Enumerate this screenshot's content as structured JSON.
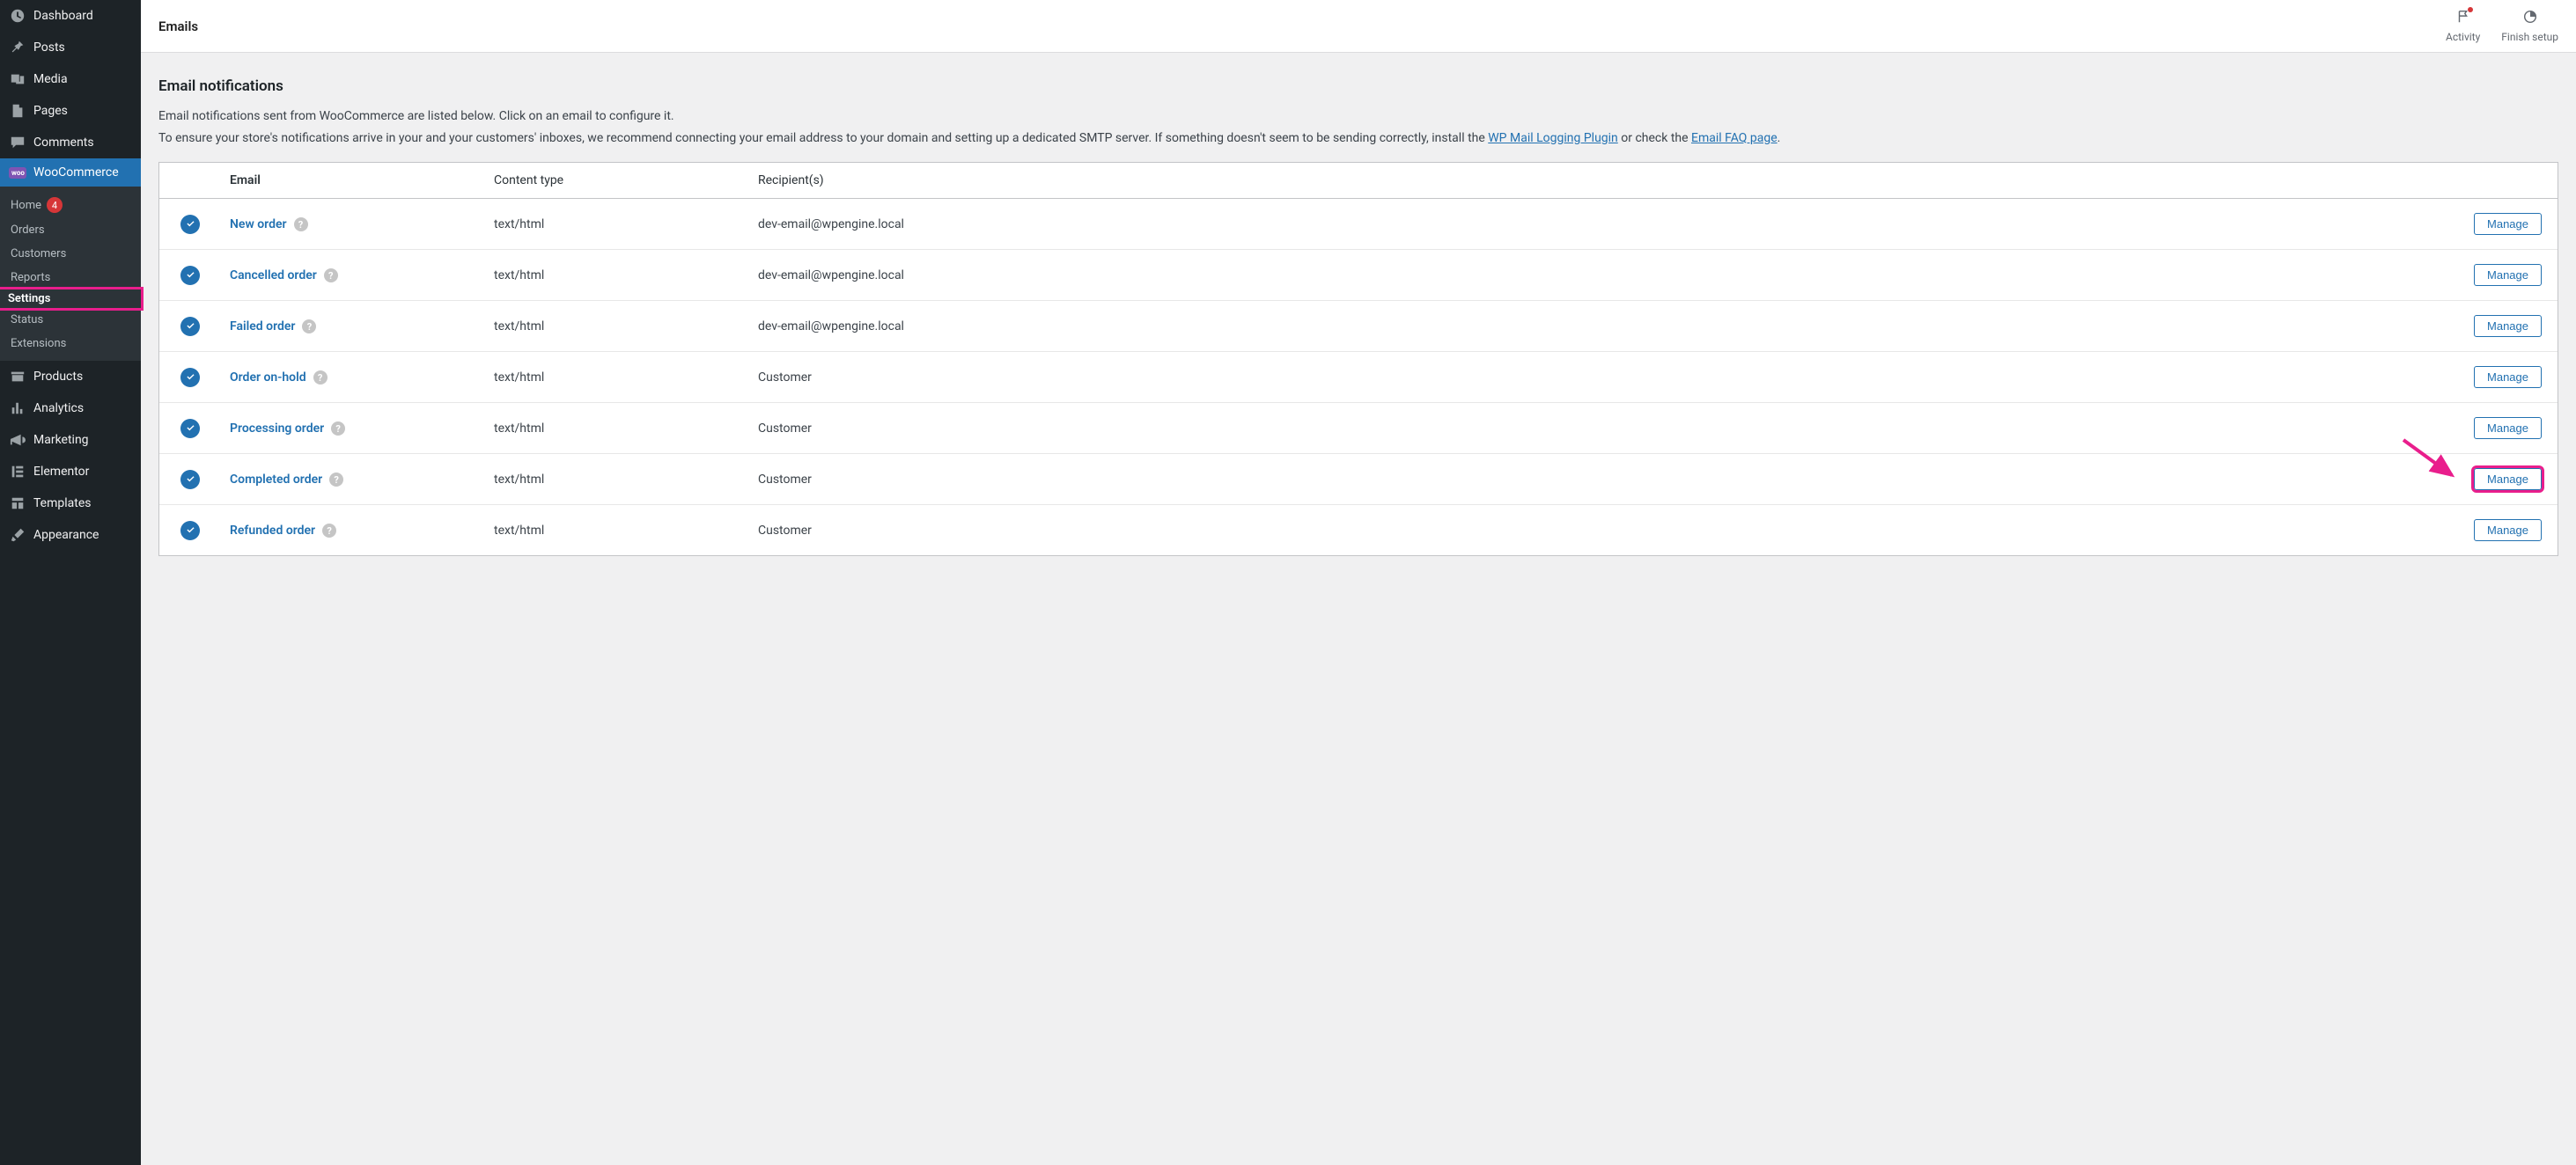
{
  "accent": "#2271b1",
  "highlight": "#e91e8c",
  "sidebar": {
    "items": [
      {
        "label": "Dashboard",
        "icon": "dashboard"
      },
      {
        "label": "Posts",
        "icon": "pin"
      },
      {
        "label": "Media",
        "icon": "media"
      },
      {
        "label": "Pages",
        "icon": "page"
      },
      {
        "label": "Comments",
        "icon": "comment"
      },
      {
        "label": "WooCommerce",
        "icon": "woo",
        "active": true
      },
      {
        "label": "Products",
        "icon": "archive"
      },
      {
        "label": "Analytics",
        "icon": "chart"
      },
      {
        "label": "Marketing",
        "icon": "megaphone"
      },
      {
        "label": "Elementor",
        "icon": "elementor"
      },
      {
        "label": "Templates",
        "icon": "templates"
      },
      {
        "label": "Appearance",
        "icon": "brush"
      }
    ],
    "submenu": [
      {
        "label": "Home",
        "badge": "4"
      },
      {
        "label": "Orders"
      },
      {
        "label": "Customers"
      },
      {
        "label": "Reports"
      },
      {
        "label": "Settings",
        "current": true,
        "highlighted": true
      },
      {
        "label": "Status"
      },
      {
        "label": "Extensions"
      }
    ]
  },
  "topbar": {
    "title": "Emails",
    "actions": [
      {
        "label": "Activity",
        "icon": "flag",
        "dot": true
      },
      {
        "label": "Finish setup",
        "icon": "progress"
      }
    ]
  },
  "page": {
    "heading": "Email notifications",
    "help_line1": "Email notifications sent from WooCommerce are listed below. Click on an email to configure it.",
    "help_line2_pre": "To ensure your store's notifications arrive in your and your customers' inboxes, we recommend connecting your email address to your domain and setting up a dedicated SMTP server. If something doesn't seem to be sending correctly, install the ",
    "help_link1": "WP Mail Logging Plugin",
    "help_line2_mid": " or check the ",
    "help_link2": "Email FAQ page",
    "help_line2_post": "."
  },
  "table": {
    "columns": {
      "email": "Email",
      "content_type": "Content type",
      "recipients": "Recipient(s)"
    },
    "manage_label": "Manage",
    "rows": [
      {
        "name": "New order",
        "content_type": "text/html",
        "recipient": "dev-email@wpengine.local",
        "enabled": true
      },
      {
        "name": "Cancelled order",
        "content_type": "text/html",
        "recipient": "dev-email@wpengine.local",
        "enabled": true
      },
      {
        "name": "Failed order",
        "content_type": "text/html",
        "recipient": "dev-email@wpengine.local",
        "enabled": true
      },
      {
        "name": "Order on-hold",
        "content_type": "text/html",
        "recipient": "Customer",
        "enabled": true
      },
      {
        "name": "Processing order",
        "content_type": "text/html",
        "recipient": "Customer",
        "enabled": true
      },
      {
        "name": "Completed order",
        "content_type": "text/html",
        "recipient": "Customer",
        "enabled": true,
        "highlight_manage": true
      },
      {
        "name": "Refunded order",
        "content_type": "text/html",
        "recipient": "Customer",
        "enabled": true
      }
    ]
  }
}
